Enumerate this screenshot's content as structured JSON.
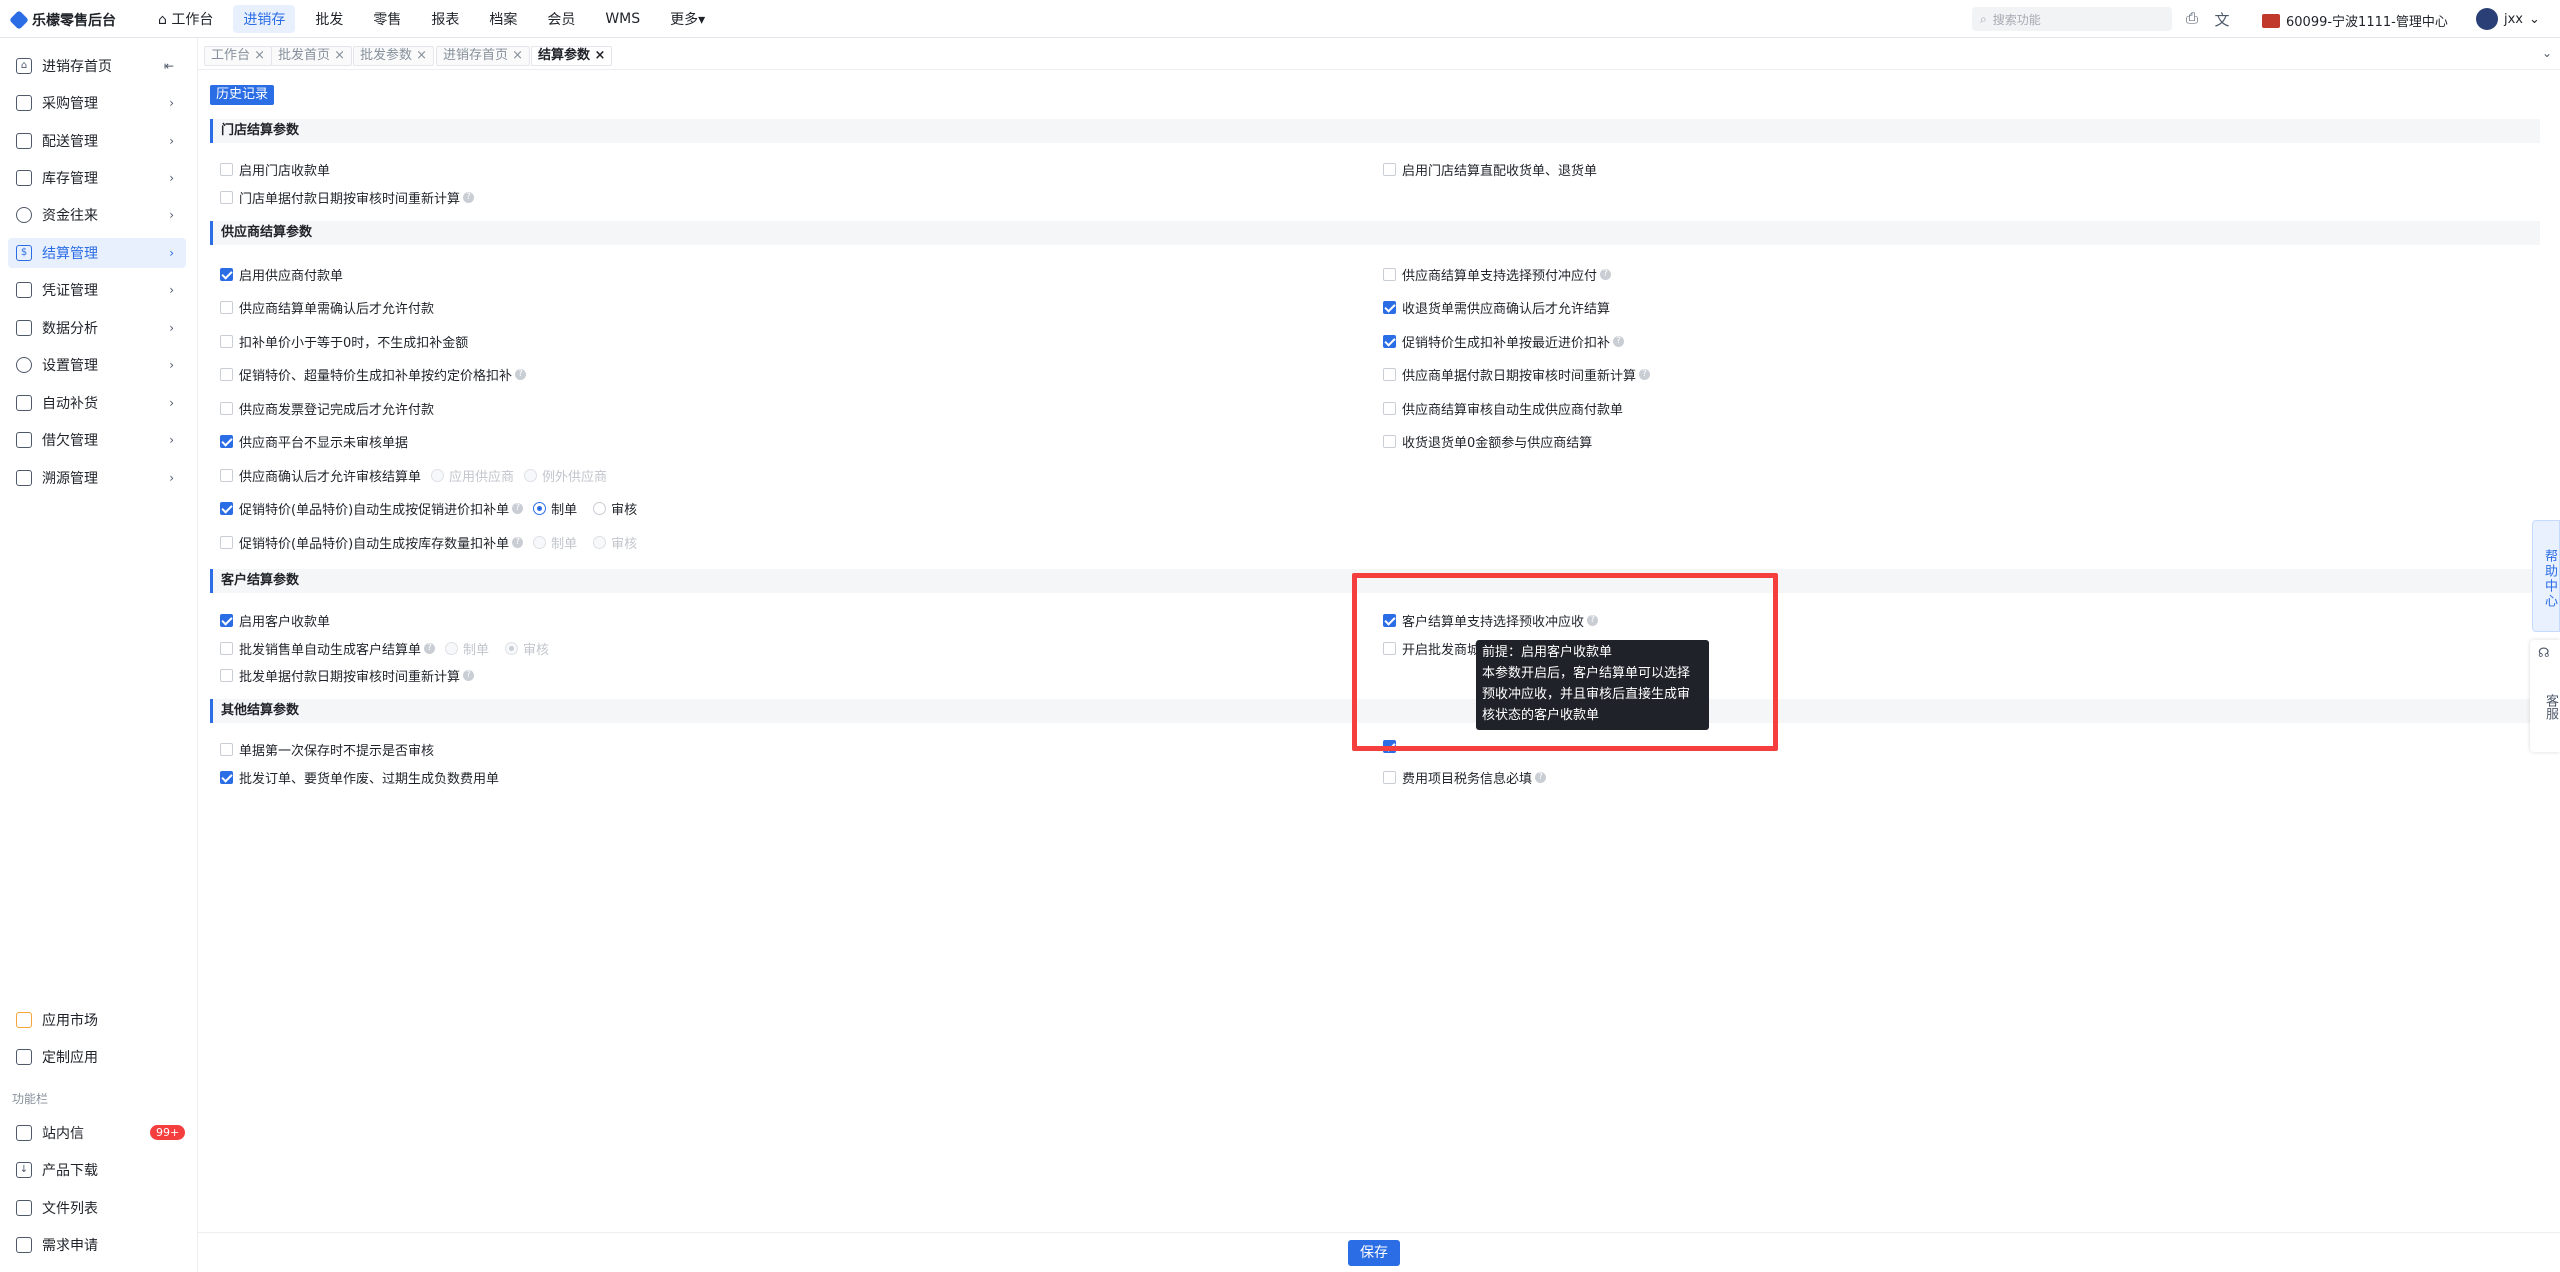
{
  "app": {
    "title": "乐檬零售后台"
  },
  "topnav": [
    "工作台",
    "进销存",
    "批发",
    "零售",
    "报表",
    "档案",
    "会员",
    "WMS",
    "更多"
  ],
  "search": {
    "placeholder": "搜索功能"
  },
  "store": "60099-宁波1111-管理中心",
  "user": "jxx",
  "sidebar": {
    "items": [
      {
        "label": "进销存首页",
        "icon": "home-icon"
      },
      {
        "label": "采购管理",
        "icon": "cart-icon"
      },
      {
        "label": "配送管理",
        "icon": "box-icon"
      },
      {
        "label": "库存管理",
        "icon": "inventory-icon"
      },
      {
        "label": "资金往来",
        "icon": "money-icon"
      },
      {
        "label": "结算管理",
        "icon": "settle-icon"
      },
      {
        "label": "凭证管理",
        "icon": "doc-icon"
      },
      {
        "label": "数据分析",
        "icon": "chart-icon"
      },
      {
        "label": "设置管理",
        "icon": "gear-icon"
      },
      {
        "label": "自动补货",
        "icon": "truck-icon"
      },
      {
        "label": "借欠管理",
        "icon": "db-icon"
      },
      {
        "label": "溯源管理",
        "icon": "trace-icon"
      }
    ],
    "bottom": [
      {
        "label": "应用市场",
        "icon": "apps-icon"
      },
      {
        "label": "定制应用",
        "icon": "custom-icon"
      }
    ],
    "section_label": "功能栏",
    "func": [
      {
        "label": "站内信",
        "icon": "mail-icon",
        "badge": "99+"
      },
      {
        "label": "产品下载",
        "icon": "download-icon"
      },
      {
        "label": "文件列表",
        "icon": "file-icon"
      },
      {
        "label": "需求申请",
        "icon": "request-icon"
      }
    ]
  },
  "tabs": [
    "工作台",
    "批发首页",
    "批发参数",
    "进销存首页",
    "结算参数"
  ],
  "history_btn": "历史记录",
  "sections": {
    "store": "门店结算参数",
    "supplier": "供应商结算参数",
    "customer": "客户结算参数",
    "other": "其他结算参数"
  },
  "store_opts": {
    "a": "启用门店收款单",
    "b": "门店单据付款日期按审核时间重新计算",
    "c": "启用门店结算直配收货单、退货单"
  },
  "supplier_opts": {
    "l1": "启用供应商付款单",
    "l2": "供应商结算单需确认后才允许付款",
    "l3": "扣补单价小于等于0时，不生成扣补金额",
    "l4": "促销特价、超量特价生成扣补单按约定价格扣补",
    "l5": "供应商发票登记完成后才允许付款",
    "l6": "供应商平台不显示未审核单据",
    "l7": "供应商确认后才允许审核结算单",
    "l7r1": "应用供应商",
    "l7r2": "例外供应商",
    "l8": "促销特价(单品特价)自动生成按促销进价扣补单",
    "l8r1": "制单",
    "l8r2": "审核",
    "l9": "促销特价(单品特价)自动生成按库存数量扣补单",
    "l9r1": "制单",
    "l9r2": "审核",
    "r1": "供应商结算单支持选择预付冲应付",
    "r2": "收退货单需供应商确认后才允许结算",
    "r3": "促销特价生成扣补单按最近进价扣补",
    "r4": "供应商单据付款日期按审核时间重新计算",
    "r5": "供应商结算审核自动生成供应商付款单",
    "r6": "收货退货单0金额参与供应商结算"
  },
  "customer_opts": {
    "l1": "启用客户收款单",
    "l2": "批发销售单自动生成客户结算单",
    "l2r1": "制单",
    "l2r2": "审核",
    "l3": "批发单据付款日期按审核时间重新计算",
    "r1": "客户结算单支持选择预收冲应收",
    "r2": "开启批发商城"
  },
  "other_opts": {
    "l1": "单据第一次保存时不提示是否审核",
    "l2": "批发订单、要货单作废、过期生成负数费用单",
    "r1": "",
    "r2": "费用项目税务信息必填"
  },
  "tooltip": {
    "line1": "前提：启用客户收款单",
    "line2": "本参数开启后，客户结算单可以选择",
    "line3": "预收冲应收，并且审核后直接生成审",
    "line4": "核状态的客户收款单"
  },
  "float": {
    "help": "帮助中心",
    "cs": "客服"
  },
  "save_btn": "保存",
  "colors": {
    "accent": "#2b6de5",
    "highlight": "#f53f3f"
  }
}
